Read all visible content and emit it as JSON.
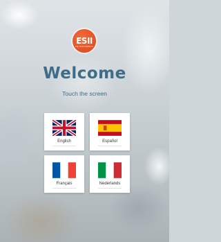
{
  "logo": {
    "text": "ESII",
    "subtext": "ESII ELECTRONICS"
  },
  "welcome": {
    "title": "Welcome",
    "subtitle": "Touch the screen"
  },
  "languages": [
    {
      "label": "English",
      "flag": "uk-flag-icon"
    },
    {
      "label": "Español",
      "flag": "spain-flag-icon"
    },
    {
      "label": "Français",
      "flag": "france-flag-icon"
    },
    {
      "label": "Nederlands",
      "flag": "italy-flag-icon"
    }
  ],
  "colors": {
    "accent": "#3f6c86",
    "logo": "#e2532a"
  }
}
